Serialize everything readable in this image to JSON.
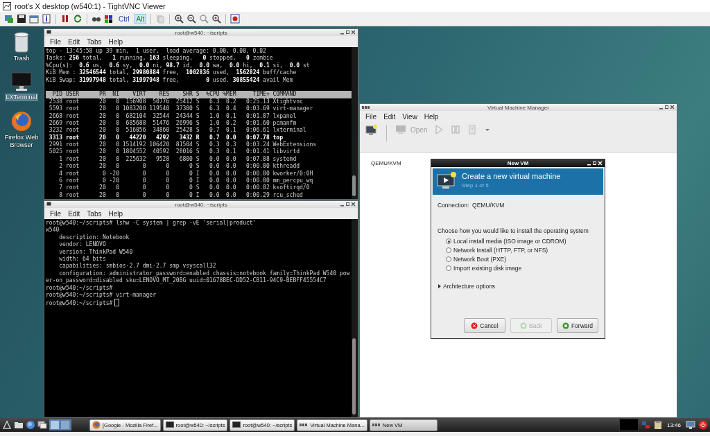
{
  "viewer": {
    "title": "root's X desktop (w540:1) - TightVNC Viewer",
    "key_buttons": [
      {
        "label": "Ctrl",
        "pressed": false
      },
      {
        "label": "Alt",
        "pressed": true
      }
    ]
  },
  "desktop_icons": [
    {
      "kind": "trash",
      "label": "Trash",
      "selected": false
    },
    {
      "kind": "terminal",
      "label": "LXTerminal",
      "selected": true
    },
    {
      "kind": "browser",
      "label": "Firefox Web Browser",
      "selected": false
    }
  ],
  "terminals": [
    {
      "title": "root@w540: ~/scripts",
      "menu": [
        "File",
        "Edit",
        "Tabs",
        "Help"
      ],
      "cursor": false,
      "lines": [
        {
          "kind": "text",
          "text": "top - 13:45:58 up 39 min,  1 user,  load average: 0.00, 0.00, 0.02"
        },
        {
          "kind": "text",
          "text": "Tasks: **256** total,   **1** running, **163** sleeping,   **0** stopped,   **0** zombie"
        },
        {
          "kind": "text",
          "text": "%Cpu(s):  **0.6** us,  **0.6** sy,  **0.0** ni, **98.7** id,  **0.0** wa,  **0.0** hi,  **0.1** si,  **0.0** st"
        },
        {
          "kind": "text",
          "text": "KiB Mem : **32546544** total, **29980884** free,  **1002836** used,  **1562824** buff/cache"
        },
        {
          "kind": "text",
          "text": "KiB Swap: **31997948** total, **31997948** free,        **0** used. **30855424** avail Mem"
        },
        {
          "kind": "header",
          "text": "  PID USER      PR  NI    VIRT    RES    SHR S  %CPU %MEM     TIME+ COMMAND"
        },
        {
          "kind": "text",
          "text": " 2538 root      20   0  156908  50776  25412 S   6.3  0.2   0:25.13 Xtightvnc"
        },
        {
          "kind": "text",
          "text": " 5593 root      20   0 1083200 119540  37300 S   6.3  0.4   0:03.69 virt-manager"
        },
        {
          "kind": "text",
          "text": " 2668 root      20   0  682104  32544  24344 S   1.0  0.1   0:01.87 lxpanel"
        },
        {
          "kind": "text",
          "text": " 2669 root      20   0  685688  51476  26996 S   1.0  0.2   0:01.60 pcmanfm"
        },
        {
          "kind": "text",
          "text": " 3232 root      20   0  516056  34860  25428 S   0.7  0.1   0:06.61 lxterminal"
        },
        {
          "kind": "bold",
          "text": " 3313 root      20   0   44220   4292   3432 R   0.7  0.0   0:07.78 top"
        },
        {
          "kind": "text",
          "text": " 2991 root      20   0 1514192 106420  81504 S   0.3  0.3   0:03.24 WebExtensions"
        },
        {
          "kind": "text",
          "text": " 5025 root      20   0 1804552  40592  28016 S   0.3  0.1   0:01.41 libvirtd"
        },
        {
          "kind": "text",
          "text": "    1 root      20   0  225632   9528   6800 S   0.0  0.0   0:07.08 systemd"
        },
        {
          "kind": "text",
          "text": "    2 root      20   0       0      0      0 S   0.0  0.0   0:00.00 kthreadd"
        },
        {
          "kind": "text",
          "text": "    4 root       0 -20       0      0      0 I   0.0  0.0   0:00.00 kworker/0:0H"
        },
        {
          "kind": "text",
          "text": "    6 root       0 -20       0      0      0 I   0.0  0.0   0:00.00 mm_percpu_wq"
        },
        {
          "kind": "text",
          "text": "    7 root      20   0       0      0      0 S   0.0  0.0   0:00.02 ksoftirqd/0"
        },
        {
          "kind": "text",
          "text": "    8 root      20   0       0      0      0 I   0.0  0.0   0:00.29 rcu_sched"
        }
      ]
    },
    {
      "title": "root@w540: ~/scripts",
      "menu": [
        "File",
        "Edit",
        "Tabs",
        "Help"
      ],
      "cursor": true,
      "lines": [
        {
          "kind": "text",
          "text": "root@w540:~/scripts# lshw -C system | grep -vE 'serial|product'"
        },
        {
          "kind": "text",
          "text": "w540"
        },
        {
          "kind": "text",
          "text": "    description: Notebook"
        },
        {
          "kind": "text",
          "text": "    vendor: LENOVO"
        },
        {
          "kind": "text",
          "text": "    version: ThinkPad W540"
        },
        {
          "kind": "text",
          "text": "    width: 64 bits"
        },
        {
          "kind": "text",
          "text": "    capabilities: smbios-2.7 dmi-2.7 smp vsyscall32"
        },
        {
          "kind": "text",
          "text": "    configuration: administrator_password=enabled chassis=notebook family=ThinkPad W540 pow"
        },
        {
          "kind": "text",
          "text": "er-on_password=disabled sku=LENOVO_MT_20BG uuid=01678BEC-DD52-CB11-94C9-BEBFF45554C7"
        },
        {
          "kind": "text",
          "text": "root@w540:~/scripts#"
        },
        {
          "kind": "text",
          "text": "root@w540:~/scripts# virt-manager"
        },
        {
          "kind": "text",
          "text": "root@w540:~/scripts#"
        }
      ]
    }
  ],
  "vmm": {
    "title": "Virtual Machine Manager",
    "menu": [
      "File",
      "Edit",
      "View",
      "Help"
    ],
    "open_button": {
      "label": "Open",
      "disabled": true
    },
    "connections": [
      "QEMU/KVM"
    ]
  },
  "new_vm": {
    "title": "New VM",
    "heading": "Create a new virtual machine",
    "step": "Step 1 of 5",
    "connection": "Connection:  QEMU/KVM",
    "prompt": "Choose how you would like to install the operating system",
    "options": [
      {
        "label": "Local install media (ISO image or CDROM)",
        "selected": true
      },
      {
        "label": "Network Install (HTTP, FTP, or NFS)",
        "selected": false
      },
      {
        "label": "Network Boot (PXE)",
        "selected": false
      },
      {
        "label": "Import existing disk image",
        "selected": false
      }
    ],
    "expander": {
      "label": "Architecture options",
      "expanded": false
    },
    "buttons": [
      {
        "kind": "cancel",
        "label": "Cancel",
        "disabled": false
      },
      {
        "kind": "back",
        "label": "Back",
        "disabled": true
      },
      {
        "kind": "forward",
        "label": "Forward",
        "disabled": false
      }
    ]
  },
  "taskbar": {
    "tasks": [
      {
        "kind": "browser",
        "label": "[Google - Mozilla Firef...",
        "selected": false
      },
      {
        "kind": "terminal",
        "label": "root@w540: ~/scripts",
        "selected": false
      },
      {
        "kind": "terminal",
        "label": "root@w540: ~/scripts",
        "selected": false
      },
      {
        "kind": "vmm",
        "label": "Virtual Machine Mana...",
        "selected": false
      },
      {
        "kind": "vmm",
        "label": "New VM",
        "selected": true
      }
    ],
    "clock": "13:46"
  }
}
